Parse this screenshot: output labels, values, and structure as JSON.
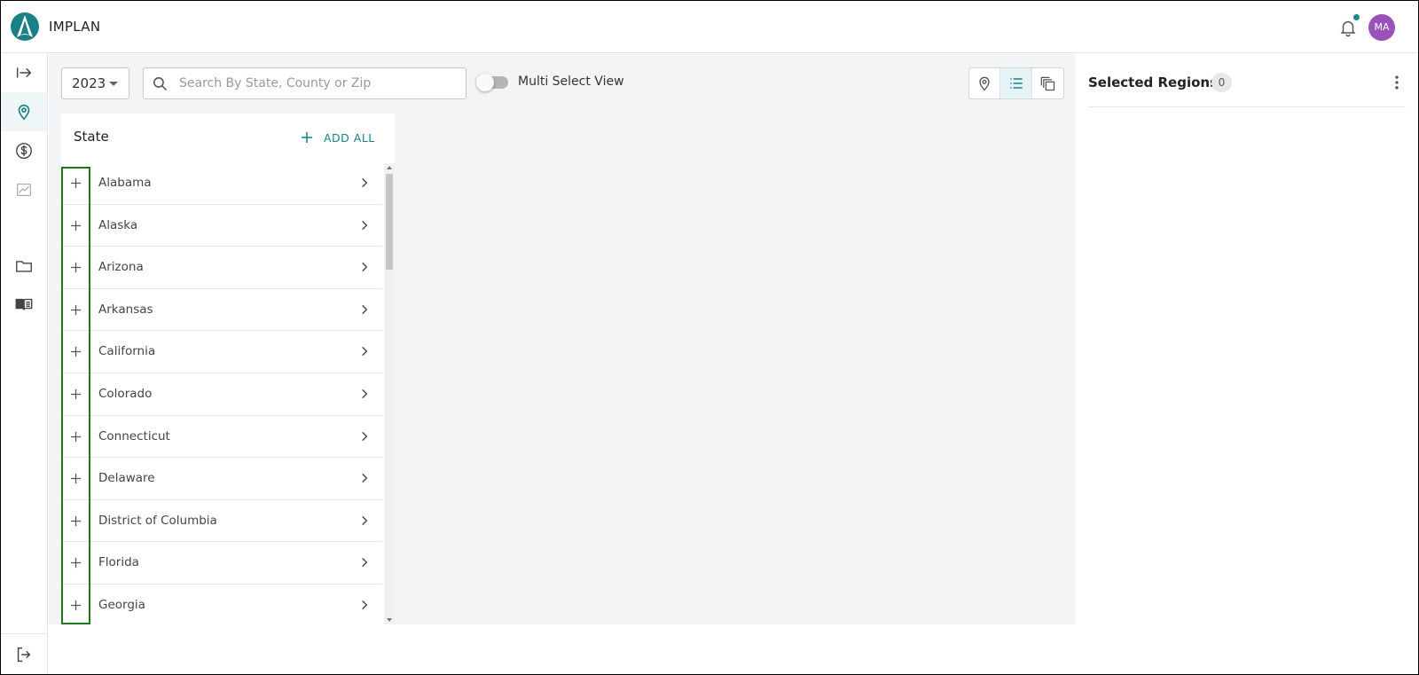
{
  "app": {
    "title": "IMPLAN"
  },
  "header": {
    "notification_has_unread": true,
    "avatar_initials": "MA",
    "avatar_color": "#9b52b8"
  },
  "colors": {
    "accent": "#1a7f86",
    "outline": "#1e7a1e"
  },
  "sidebar": {
    "items": [
      {
        "name": "expand",
        "icon": "arrow-right-to-bar-icon",
        "active": false
      },
      {
        "name": "regions",
        "icon": "map-pin-icon",
        "active": true
      },
      {
        "name": "economics",
        "icon": "dollar-circle-icon",
        "active": false
      },
      {
        "name": "results",
        "icon": "line-chart-icon",
        "active": false
      },
      {
        "name": "projects",
        "icon": "folder-icon",
        "active": false
      },
      {
        "name": "guide",
        "icon": "book-icon",
        "active": false
      }
    ],
    "footer": {
      "icon": "logout-icon"
    }
  },
  "toolbar": {
    "year": "2023",
    "search": {
      "placeholder": "Search By State, County or Zip",
      "value": ""
    },
    "multi_select": {
      "label": "Multi Select View",
      "on": false
    },
    "views": [
      {
        "name": "map-view",
        "icon": "map-pin-icon",
        "active": false
      },
      {
        "name": "list-view",
        "icon": "list-icon",
        "active": true
      },
      {
        "name": "combined-view",
        "icon": "layers-copy-icon",
        "active": false
      }
    ]
  },
  "state_panel": {
    "title": "State",
    "add_all_label": "ADD ALL",
    "states": [
      "Alabama",
      "Alaska",
      "Arizona",
      "Arkansas",
      "California",
      "Colorado",
      "Connecticut",
      "Delaware",
      "District of Columbia",
      "Florida",
      "Georgia"
    ]
  },
  "selected_regions": {
    "title": "Selected Regions",
    "count": "0"
  }
}
